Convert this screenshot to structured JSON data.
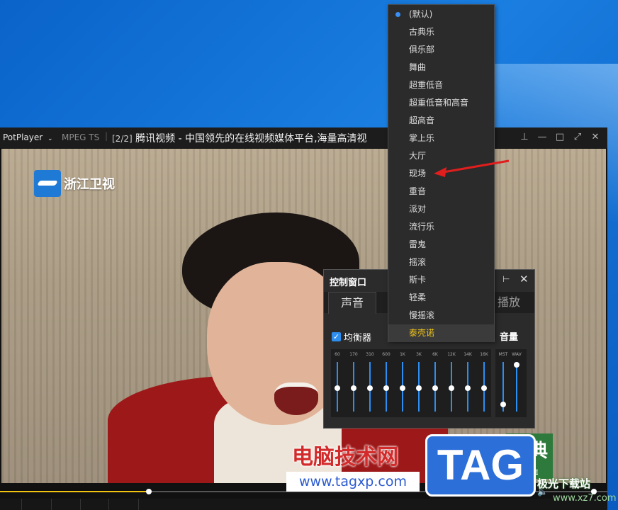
{
  "colors": {
    "accent": "#2d8ef0",
    "selected": "#f0c419",
    "desktop": "#1a7ee0"
  },
  "player": {
    "app_name": "PotPlayer",
    "app_chevron_icon": "chevron-down-icon",
    "format": "MPEG TS",
    "index": "[2/2]",
    "title": "腾讯视频 - 中国领先的在线视频媒体平台,海量高清视",
    "channel_logo": "浙江卫视",
    "badge_text": "经典",
    "badge_sub": "LINE",
    "seek_progress": 0.245,
    "volume_progress": 1.0
  },
  "control_window": {
    "title": "控制窗口",
    "tabs": [
      {
        "label": "声音",
        "active": true
      },
      {
        "label": "播放",
        "active": false
      }
    ],
    "equalizer_label": "均衡器",
    "equalizer_checked": true,
    "volume_label": "音量",
    "bands": [
      {
        "label": "60",
        "level": 0.5
      },
      {
        "label": "170",
        "level": 0.5
      },
      {
        "label": "310",
        "level": 0.5
      },
      {
        "label": "600",
        "level": 0.5
      },
      {
        "label": "1K",
        "level": 0.5
      },
      {
        "label": "3K",
        "level": 0.5
      },
      {
        "label": "6K",
        "level": 0.5
      },
      {
        "label": "12K",
        "level": 0.5
      },
      {
        "label": "14K",
        "level": 0.5
      },
      {
        "label": "16K",
        "level": 0.5
      }
    ],
    "volume_bands": [
      {
        "label": "MST",
        "level": 0.15
      },
      {
        "label": "WAV",
        "level": 1.0
      }
    ]
  },
  "menu": {
    "items": [
      {
        "label": "(默认)",
        "radio": true,
        "selected": false
      },
      {
        "label": "古典乐",
        "radio": false,
        "selected": false
      },
      {
        "label": "俱乐部",
        "radio": false,
        "selected": false
      },
      {
        "label": "舞曲",
        "radio": false,
        "selected": false
      },
      {
        "label": "超重低音",
        "radio": false,
        "selected": false
      },
      {
        "label": "超重低音和高音",
        "radio": false,
        "selected": false
      },
      {
        "label": "超高音",
        "radio": false,
        "selected": false
      },
      {
        "label": "掌上乐",
        "radio": false,
        "selected": false
      },
      {
        "label": "大厅",
        "radio": false,
        "selected": false
      },
      {
        "label": "现场",
        "radio": false,
        "selected": false
      },
      {
        "label": "重音",
        "radio": false,
        "selected": false
      },
      {
        "label": "派对",
        "radio": false,
        "selected": false
      },
      {
        "label": "流行乐",
        "radio": false,
        "selected": false
      },
      {
        "label": "雷鬼",
        "radio": false,
        "selected": false
      },
      {
        "label": "摇滚",
        "radio": false,
        "selected": false
      },
      {
        "label": "斯卡",
        "radio": false,
        "selected": false
      },
      {
        "label": "轻柔",
        "radio": false,
        "selected": false
      },
      {
        "label": "慢摇滚",
        "radio": false,
        "selected": false
      },
      {
        "label": "泰壳诺",
        "radio": false,
        "selected": true
      }
    ]
  },
  "watermarks": {
    "site_cn": "电脑技术网",
    "site_url": "www.tagxp.com",
    "tag": "TAG",
    "site2_cn": "极光下载站",
    "site2_url": "www.xz7.com"
  }
}
